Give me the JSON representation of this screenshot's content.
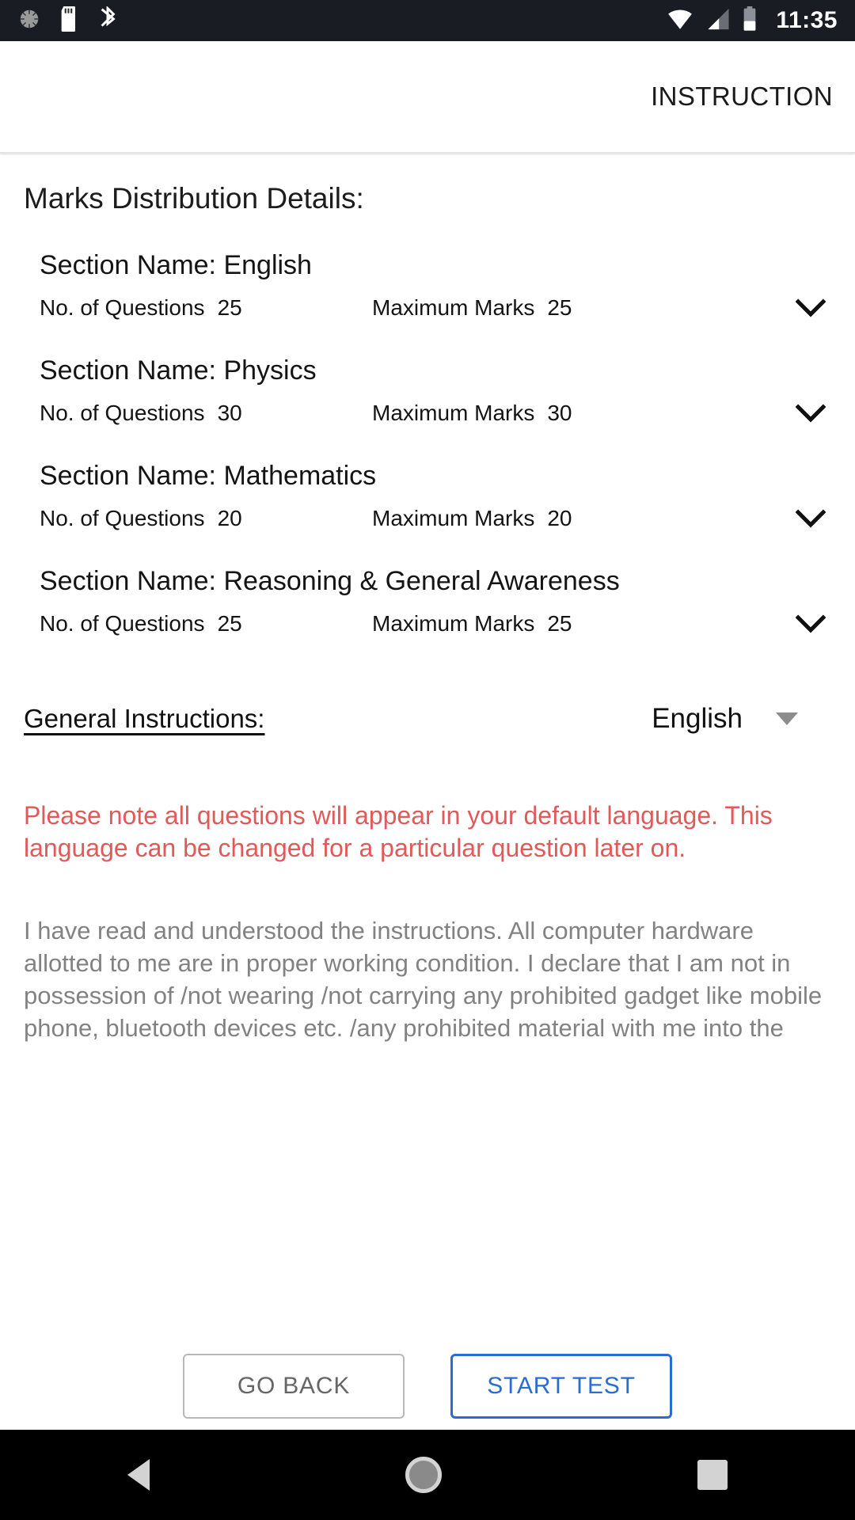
{
  "status_bar": {
    "time": "11:35",
    "left_icons": [
      "sync-progress-icon",
      "sd-card-icon",
      "bluetooth-disabled-icon"
    ],
    "right_icons": [
      "wifi-icon",
      "cellular-signal-icon",
      "battery-icon"
    ]
  },
  "app_bar": {
    "title": "INSTRUCTION"
  },
  "main": {
    "page_title": "Marks Distribution Details:",
    "labels": {
      "section_prefix": "Section Name: ",
      "questions": "No. of Questions",
      "marks": "Maximum Marks"
    },
    "sections": [
      {
        "name": "English",
        "questions": "25",
        "marks": "25"
      },
      {
        "name": "Physics",
        "questions": "30",
        "marks": "30"
      },
      {
        "name": "Mathematics",
        "questions": "20",
        "marks": "20"
      },
      {
        "name": "Reasoning & General Awareness",
        "questions": "25",
        "marks": "25"
      }
    ],
    "general_instructions": {
      "label": "General Instructions:",
      "language_value": "English"
    },
    "warning_text": "Please note all questions will appear in your default language. This language can be changed for a particular question later on.",
    "declaration_text": "I have read and understood the instructions. All computer hardware allotted to me are in proper working condition. I declare that I am not in possession of /not wearing /not carrying any prohibited gadget like mobile phone, bluetooth devices etc. /any prohibited material with me into the"
  },
  "actions": {
    "go_back": "GO BACK",
    "start_test": "START TEST"
  },
  "colors": {
    "warning_red": "#e05a5a",
    "primary_blue": "#2b6cd4",
    "declaration_gray": "#828282"
  }
}
